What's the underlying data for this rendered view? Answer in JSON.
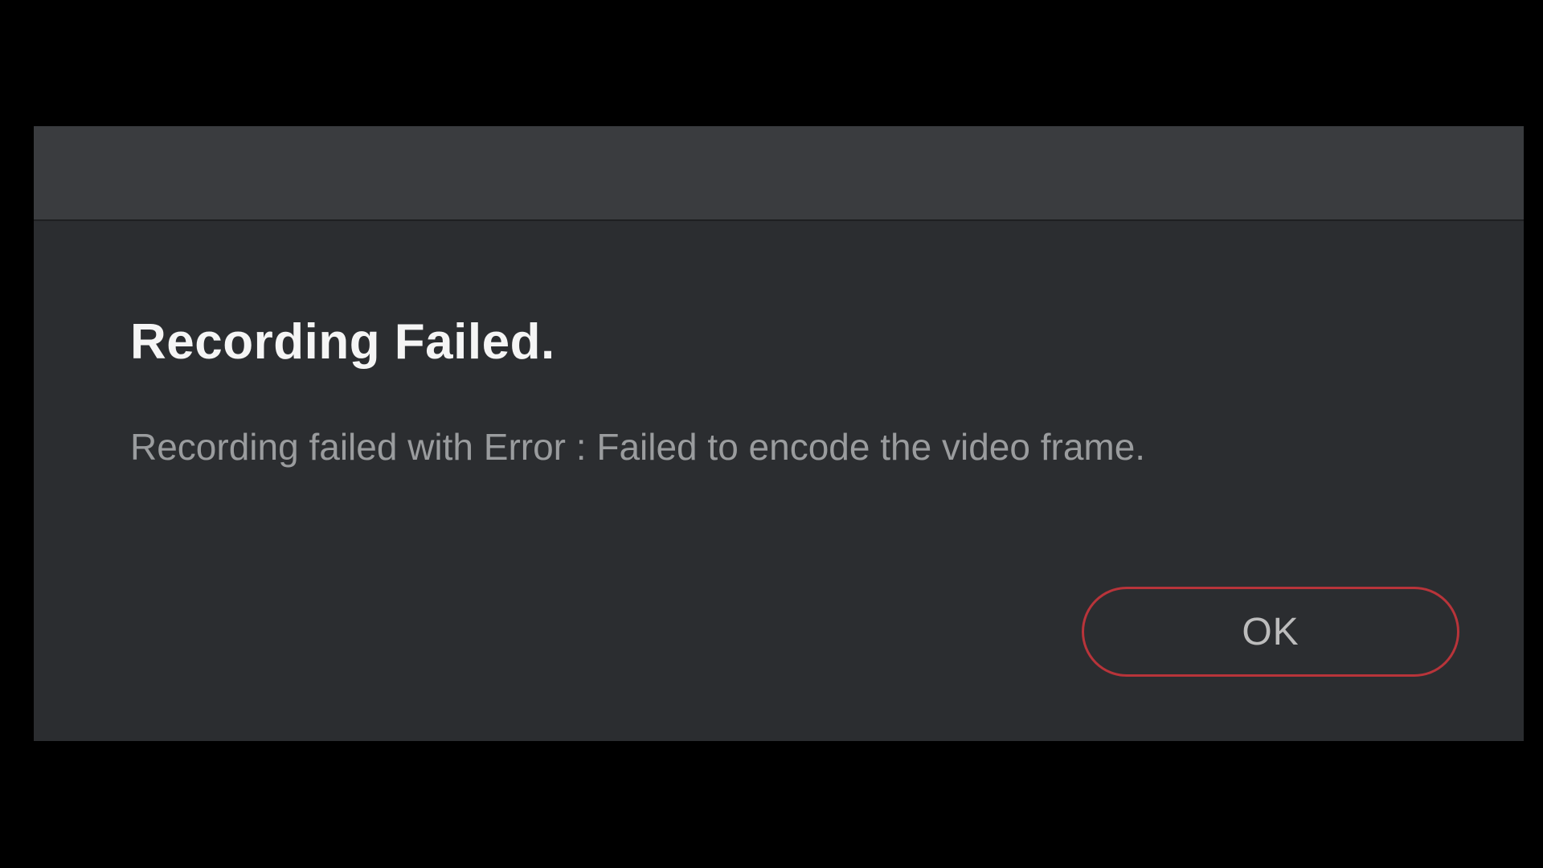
{
  "dialog": {
    "title": "Recording Failed.",
    "message": "Recording failed with Error : Failed to encode the video frame.",
    "ok_label": "OK"
  }
}
